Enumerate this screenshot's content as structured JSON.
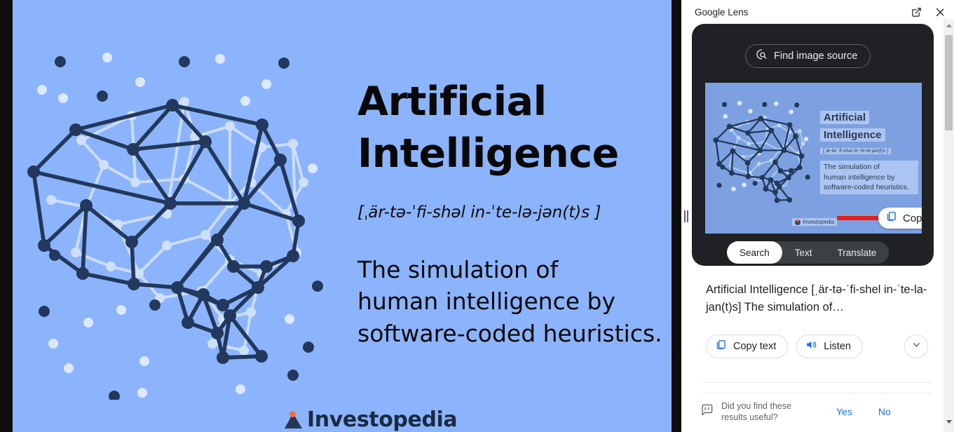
{
  "page": {
    "image_card": {
      "background_color": "#8cb4fc",
      "title": "Artificial\nIntelligence",
      "pronunciation": "[ˌär-tə-ˈfi-shəl in-ˈte-lə-jən(t)s ]",
      "definition": "The simulation of\nhuman intelligence by\nsoftware-coded heuristics.",
      "brand": "Investopedia",
      "brand_mark_color": "#ff6b3d",
      "graphic_name": "network-brain-illustration"
    }
  },
  "drag_handle": {
    "name": "panel-resize-handle"
  },
  "lens": {
    "header": {
      "title": "Google Lens",
      "open_in_new_icon": "open-in-new-icon",
      "close_icon": "close-icon"
    },
    "find_image_source": {
      "label": "Find image source",
      "icon": "lens-search-icon"
    },
    "thumbnail": {
      "title_line1": "Artificial",
      "title_line2": "Intelligence",
      "pronunciation": "[ˌär-tə-ˈfi-shəl in-ˈte-lə-jən(t)s ]",
      "definition": "The simulation of\nhuman intelligence by\nsoftware-coded heuristics.",
      "brand": "Investopedia",
      "copy_button_label": "Copy",
      "copy_button_icon": "copy-icon",
      "arrow_color": "#ea1c1c",
      "highlight_color": "rgba(210,226,255,0.55)"
    },
    "tabs": [
      {
        "label": "Search",
        "active": true
      },
      {
        "label": "Text",
        "active": false
      },
      {
        "label": "Translate",
        "active": false
      }
    ],
    "result": {
      "text": "Artificial Intelligence [ˌär-tə-ˈfi-shel in-ˈte-la-jan(t)s] The simulation of…"
    },
    "actions": {
      "copy_text": {
        "label": "Copy text",
        "icon": "copy-icon"
      },
      "listen": {
        "label": "Listen",
        "icon": "volume-up-icon"
      },
      "expand": {
        "icon": "chevron-down-icon"
      }
    },
    "feedback": {
      "icon": "feedback-icon",
      "question": "Did you find these results useful?",
      "yes_label": "Yes",
      "no_label": "No",
      "link_color": "#1a73e8"
    },
    "scrollbar": {
      "up_icon": "scroll-up-arrow-icon",
      "down_icon": "scroll-down-arrow-icon",
      "thumb": "scrollbar-thumb"
    }
  }
}
